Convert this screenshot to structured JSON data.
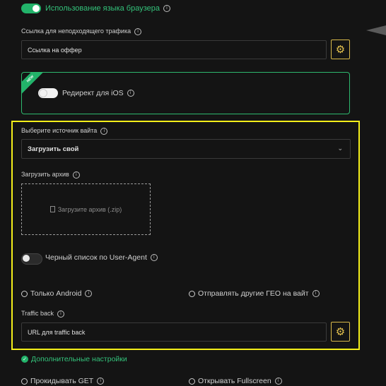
{
  "browser_lang": {
    "label": "Использование языка браузера",
    "enabled": true
  },
  "traffic_link": {
    "label": "Ссылка для неподходящего трафика",
    "value": "Ссылка на оффер"
  },
  "ios_redirect": {
    "badge": "NEW",
    "label": "Редирект для iOS",
    "enabled": false
  },
  "source": {
    "label": "Выберите источник вайта",
    "selected": "Загрузить свой"
  },
  "archive": {
    "label": "Загрузить архив",
    "dropzone_text": "Загрузите архив (.zip)"
  },
  "blacklist": {
    "label": "Черный список по User-Agent",
    "enabled": false
  },
  "radios": {
    "only_android": "Только Android",
    "other_geo": "Отправлять другие ГЕО на вайт"
  },
  "traffic_back": {
    "label": "Traffic back",
    "value": "URL для traffic back"
  },
  "advanced": {
    "label": "Дополнительные настройки"
  },
  "bottom_radios": {
    "pass_get": "Прокидывать GET",
    "fullscreen": "Открывать Fullscreen"
  },
  "colors": {
    "accent_green": "#22b36a",
    "highlight": "#f4ef1a",
    "gear": "#d9b94a"
  }
}
